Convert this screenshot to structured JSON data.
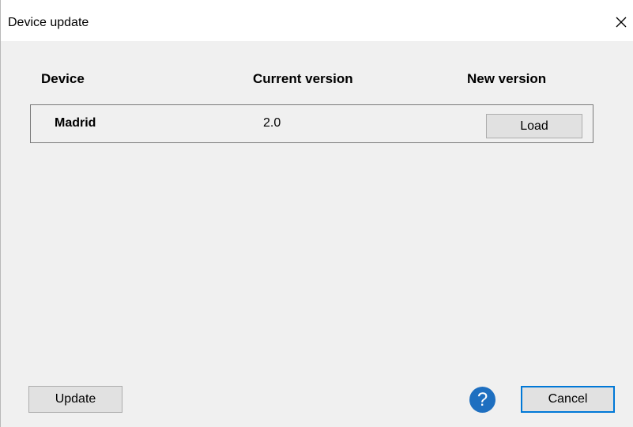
{
  "window": {
    "title": "Device update"
  },
  "headers": {
    "device": "Device",
    "current_version": "Current version",
    "new_version": "New version"
  },
  "devices": [
    {
      "name": "Madrid",
      "current_version": "2.0",
      "load_label": "Load"
    }
  ],
  "footer": {
    "update_label": "Update",
    "help_glyph": "?",
    "cancel_label": "Cancel"
  },
  "icons": {
    "close": "close-icon",
    "help": "help-icon"
  },
  "colors": {
    "window_bg": "#f0f0f0",
    "titlebar_bg": "#ffffff",
    "button_bg": "#e1e1e1",
    "focus_border": "#0078d7",
    "help_icon_bg": "#1e6fc0"
  }
}
